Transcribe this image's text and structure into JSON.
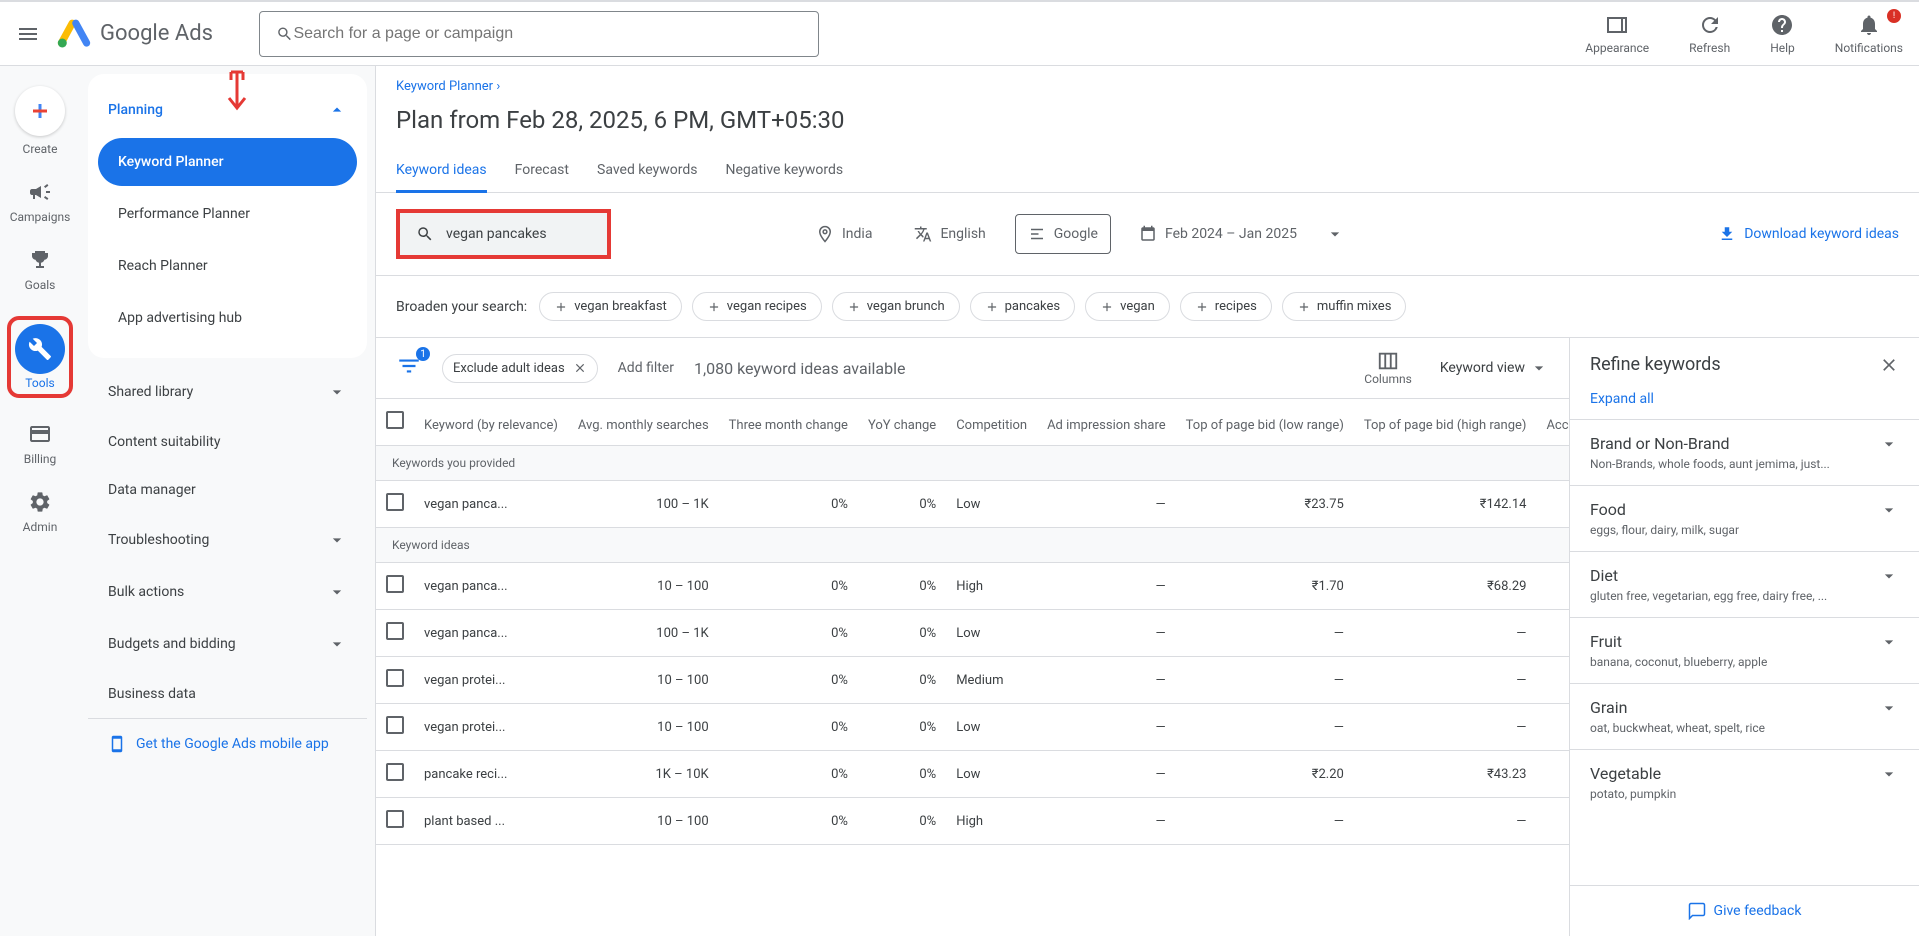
{
  "header": {
    "logo_text": "Google Ads",
    "search_placeholder": "Search for a page or campaign",
    "actions": {
      "appearance": "Appearance",
      "refresh": "Refresh",
      "help": "Help",
      "notifications": "Notifications",
      "notif_badge": "!"
    }
  },
  "left_rail": {
    "create": "Create",
    "campaigns": "Campaigns",
    "goals": "Goals",
    "tools": "Tools",
    "billing": "Billing",
    "admin": "Admin"
  },
  "sub_nav": {
    "planning": "Planning",
    "keyword_planner": "Keyword Planner",
    "performance_planner": "Performance Planner",
    "reach_planner": "Reach Planner",
    "app_hub": "App advertising hub",
    "shared_library": "Shared library",
    "content_suitability": "Content suitability",
    "data_manager": "Data manager",
    "troubleshooting": "Troubleshooting",
    "bulk_actions": "Bulk actions",
    "budgets_bidding": "Budgets and bidding",
    "business_data": "Business data",
    "mobile_app": "Get the Google Ads mobile app"
  },
  "breadcrumb": {
    "keyword_planner": "Keyword Planner",
    "arrow": "›"
  },
  "page_title": "Plan from Feb 28, 2025, 6 PM, GMT+05:30",
  "tabs": {
    "keyword_ideas": "Keyword ideas",
    "forecast": "Forecast",
    "saved_keywords": "Saved keywords",
    "negative_keywords": "Negative keywords"
  },
  "filters": {
    "search_term": "vegan pancakes",
    "location": "India",
    "language": "English",
    "network": "Google",
    "date_range": "Feb 2024 – Jan 2025",
    "download": "Download keyword ideas"
  },
  "broaden": {
    "label": "Broaden your search:",
    "chips": [
      "vegan breakfast",
      "vegan recipes",
      "vegan brunch",
      "pancakes",
      "vegan",
      "recipes",
      "muffin mixes"
    ]
  },
  "toolbar": {
    "filter_count": "1",
    "exclude_adult": "Exclude adult ideas",
    "add_filter": "Add filter",
    "available": "1,080 keyword ideas available",
    "columns": "Columns",
    "view": "Keyword view"
  },
  "table": {
    "headers": {
      "keyword": "Keyword (by relevance)",
      "avg_monthly": "Avg. monthly searches",
      "three_month": "Three month change",
      "yoy": "YoY change",
      "competition": "Competition",
      "ad_impression": "Ad impression share",
      "bid_low": "Top of page bid (low range)",
      "bid_high": "Top of page bid (high range)",
      "account_status": "Account status"
    },
    "section_provided": "Keywords you provided",
    "section_ideas": "Keyword ideas",
    "rows_provided": [
      {
        "kw": "vegan panca...",
        "avg": "100 – 1K",
        "tm": "0%",
        "yoy": "0%",
        "comp": "Low",
        "imp": "—",
        "low": "₹23.75",
        "high": "₹142.14",
        "status": ""
      }
    ],
    "rows_ideas": [
      {
        "kw": "vegan panca...",
        "avg": "10 – 100",
        "tm": "0%",
        "yoy": "0%",
        "comp": "High",
        "imp": "—",
        "low": "₹1.70",
        "high": "₹68.29",
        "status": ""
      },
      {
        "kw": "vegan panca...",
        "avg": "100 – 1K",
        "tm": "0%",
        "yoy": "0%",
        "comp": "Low",
        "imp": "—",
        "low": "—",
        "high": "—",
        "status": ""
      },
      {
        "kw": "vegan protei...",
        "avg": "10 – 100",
        "tm": "0%",
        "yoy": "0%",
        "comp": "Medium",
        "imp": "—",
        "low": "—",
        "high": "—",
        "status": ""
      },
      {
        "kw": "vegan protei...",
        "avg": "10 – 100",
        "tm": "0%",
        "yoy": "0%",
        "comp": "Low",
        "imp": "—",
        "low": "—",
        "high": "—",
        "status": ""
      },
      {
        "kw": "pancake reci...",
        "avg": "1K – 10K",
        "tm": "0%",
        "yoy": "0%",
        "comp": "Low",
        "imp": "—",
        "low": "₹2.20",
        "high": "₹43.23",
        "status": ""
      },
      {
        "kw": "plant based ...",
        "avg": "10 – 100",
        "tm": "0%",
        "yoy": "0%",
        "comp": "High",
        "imp": "—",
        "low": "—",
        "high": "—",
        "status": ""
      }
    ]
  },
  "refine": {
    "title": "Refine keywords",
    "expand_all": "Expand all",
    "groups": [
      {
        "title": "Brand or Non-Brand",
        "sub": "Non-Brands, whole foods, aunt jemima, just..."
      },
      {
        "title": "Food",
        "sub": "eggs, flour, dairy, milk, sugar"
      },
      {
        "title": "Diet",
        "sub": "gluten free, vegetarian, egg free, dairy free, ..."
      },
      {
        "title": "Fruit",
        "sub": "banana, coconut, blueberry, apple"
      },
      {
        "title": "Grain",
        "sub": "oat, buckwheat, wheat, spelt, rice"
      },
      {
        "title": "Vegetable",
        "sub": "potato, pumpkin"
      }
    ],
    "feedback": "Give feedback"
  }
}
